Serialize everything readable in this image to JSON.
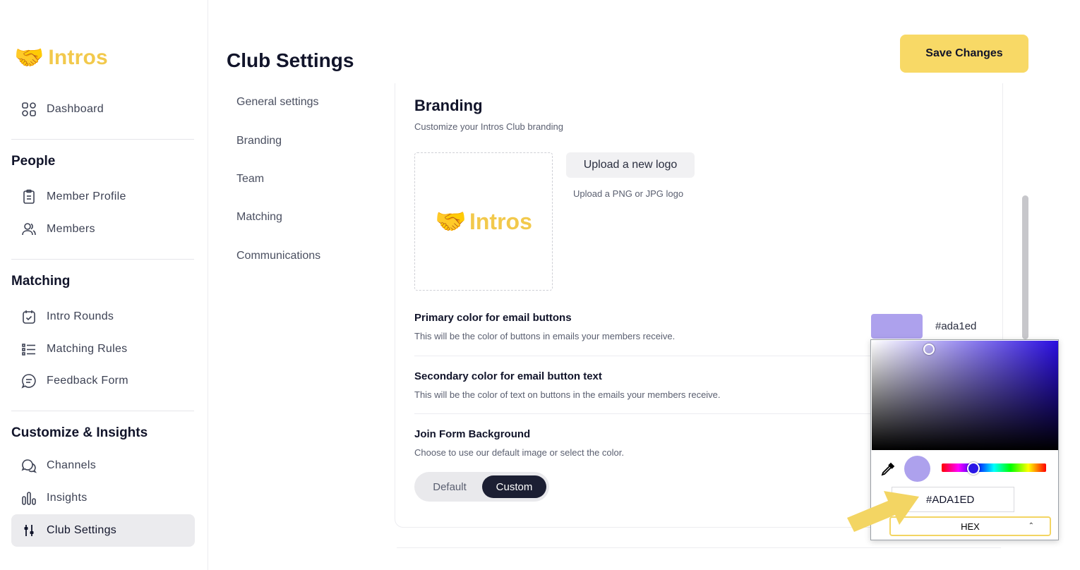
{
  "brand": {
    "name": "Intros",
    "logo_emoji": "🤝",
    "color": "#f2c94c"
  },
  "sidebar": {
    "dashboard": "Dashboard",
    "sections": {
      "people": {
        "title": "People",
        "items": [
          "Member Profile",
          "Members"
        ]
      },
      "matching": {
        "title": "Matching",
        "items": [
          "Intro Rounds",
          "Matching Rules",
          "Feedback Form"
        ]
      },
      "customize": {
        "title": "Customize & Insights",
        "items": [
          "Channels",
          "Insights",
          "Club Settings"
        ]
      }
    },
    "active_item": "Club Settings"
  },
  "header": {
    "title": "Club Settings",
    "save_label": "Save Changes"
  },
  "subnav": [
    "General settings",
    "Branding",
    "Team",
    "Matching",
    "Communications"
  ],
  "branding": {
    "title": "Branding",
    "subtitle": "Customize your Intros Club branding",
    "upload_label": "Upload a new logo",
    "upload_hint": "Upload a PNG or JPG logo",
    "primary": {
      "title": "Primary color for email buttons",
      "desc": "This will be the color of buttons in emails your members receive.",
      "value": "#ada1ed"
    },
    "secondary": {
      "title": "Secondary color for email button text",
      "desc": "This will be the color of text on buttons in the emails your members receive."
    },
    "join_form": {
      "title": "Join Form Background",
      "desc": "Choose to use our default image or select the color.",
      "options": [
        "Default",
        "Custom"
      ],
      "selected": "Custom"
    }
  },
  "color_picker": {
    "hex_value": "#ADA1ED",
    "mode": "HEX",
    "preview_color": "#ada1ed"
  },
  "colors": {
    "accent_button": "#f8d966",
    "dark": "#11142a",
    "annotation_arrow": "#f3d563"
  }
}
